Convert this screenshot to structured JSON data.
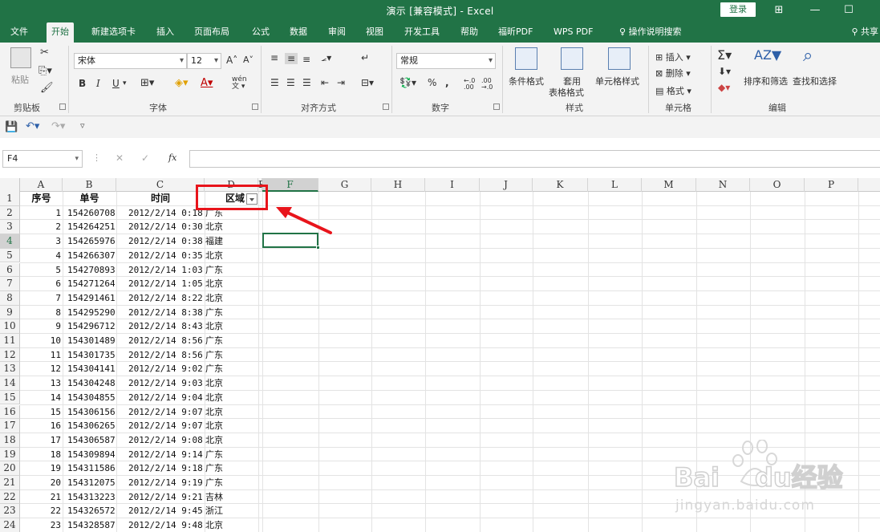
{
  "window": {
    "title": "演示 [兼容模式] - Excel",
    "login_label": "登录",
    "controls": [
      "⊞",
      "—",
      "☐"
    ]
  },
  "tabs": [
    "文件",
    "开始",
    "新建选项卡",
    "插入",
    "页面布局",
    "公式",
    "数据",
    "审阅",
    "视图",
    "开发工具",
    "帮助",
    "福昕PDF",
    "WPS PDF",
    "操作说明搜索"
  ],
  "active_tab": "开始",
  "share_label": "共享",
  "ribbon": {
    "clipboard": {
      "label": "剪贴板",
      "paste": "粘贴"
    },
    "font": {
      "label": "字体",
      "name": "宋体",
      "size": "12",
      "bold": "B",
      "italic": "I",
      "underline": "U",
      "wen": "wén"
    },
    "alignment": {
      "label": "对齐方式"
    },
    "number": {
      "label": "数字",
      "format": "常规",
      "percent": "%",
      "comma": ",",
      "inc_decimal": "←.0 .00",
      "dec_decimal": ".00 →.0"
    },
    "styles": {
      "label": "样式",
      "conditional": "条件格式",
      "table_format_1": "套用",
      "table_format_2": "表格格式",
      "cell_style": "单元格样式"
    },
    "cells": {
      "label": "单元格",
      "insert": "插入",
      "delete": "删除",
      "format": "格式"
    },
    "editing": {
      "label": "编辑",
      "sort_filter": "排序和筛选",
      "find_select": "查找和选择"
    }
  },
  "formula_bar": {
    "name_box": "F4",
    "fx": "fx",
    "cancel": "✕",
    "enter": "✓",
    "value": ""
  },
  "columns": [
    "A",
    "B",
    "C",
    "D",
    "E",
    "F",
    "G",
    "H",
    "I",
    "J",
    "K",
    "L",
    "M",
    "N",
    "O",
    "P"
  ],
  "selected_column": "F",
  "selected_row": "4",
  "sheet": {
    "headers": {
      "seq": "序号",
      "order": "单号",
      "time": "时间",
      "region": "区域"
    },
    "rows": [
      {
        "row": "2",
        "seq": "1",
        "order": "154260708",
        "time": "2012/2/14 0:18",
        "region": "广东"
      },
      {
        "row": "3",
        "seq": "2",
        "order": "154264251",
        "time": "2012/2/14 0:30",
        "region": "北京"
      },
      {
        "row": "4",
        "seq": "3",
        "order": "154265976",
        "time": "2012/2/14 0:38",
        "region": "福建"
      },
      {
        "row": "5",
        "seq": "4",
        "order": "154266307",
        "time": "2012/2/14 0:35",
        "region": "北京"
      },
      {
        "row": "6",
        "seq": "5",
        "order": "154270893",
        "time": "2012/2/14 1:03",
        "region": "广东"
      },
      {
        "row": "7",
        "seq": "6",
        "order": "154271264",
        "time": "2012/2/14 1:05",
        "region": "北京"
      },
      {
        "row": "8",
        "seq": "7",
        "order": "154291461",
        "time": "2012/2/14 8:22",
        "region": "北京"
      },
      {
        "row": "9",
        "seq": "8",
        "order": "154295290",
        "time": "2012/2/14 8:38",
        "region": "广东"
      },
      {
        "row": "10",
        "seq": "9",
        "order": "154296712",
        "time": "2012/2/14 8:43",
        "region": "北京"
      },
      {
        "row": "11",
        "seq": "10",
        "order": "154301489",
        "time": "2012/2/14 8:56",
        "region": "广东"
      },
      {
        "row": "12",
        "seq": "11",
        "order": "154301735",
        "time": "2012/2/14 8:56",
        "region": "广东"
      },
      {
        "row": "13",
        "seq": "12",
        "order": "154304141",
        "time": "2012/2/14 9:02",
        "region": "广东"
      },
      {
        "row": "14",
        "seq": "13",
        "order": "154304248",
        "time": "2012/2/14 9:03",
        "region": "北京"
      },
      {
        "row": "15",
        "seq": "14",
        "order": "154304855",
        "time": "2012/2/14 9:04",
        "region": "北京"
      },
      {
        "row": "16",
        "seq": "15",
        "order": "154306156",
        "time": "2012/2/14 9:07",
        "region": "北京"
      },
      {
        "row": "17",
        "seq": "16",
        "order": "154306265",
        "time": "2012/2/14 9:07",
        "region": "北京"
      },
      {
        "row": "18",
        "seq": "17",
        "order": "154306587",
        "time": "2012/2/14 9:08",
        "region": "北京"
      },
      {
        "row": "19",
        "seq": "18",
        "order": "154309894",
        "time": "2012/2/14 9:14",
        "region": "广东"
      },
      {
        "row": "20",
        "seq": "19",
        "order": "154311586",
        "time": "2012/2/14 9:18",
        "region": "广东"
      },
      {
        "row": "21",
        "seq": "20",
        "order": "154312075",
        "time": "2012/2/14 9:19",
        "region": "广东"
      },
      {
        "row": "22",
        "seq": "21",
        "order": "154313223",
        "time": "2012/2/14 9:21",
        "region": "吉林"
      },
      {
        "row": "23",
        "seq": "22",
        "order": "154326572",
        "time": "2012/2/14 9:45",
        "region": "浙江"
      },
      {
        "row": "24",
        "seq": "23",
        "order": "154328587",
        "time": "2012/2/14 9:48",
        "region": "北京"
      }
    ]
  },
  "watermark": {
    "brand": "Bai",
    "brand2": "du",
    "cn": "经验",
    "url": "jingyan.baidu.com"
  },
  "colors": {
    "excel_green": "#217346",
    "annotation_red": "#e8141b"
  }
}
